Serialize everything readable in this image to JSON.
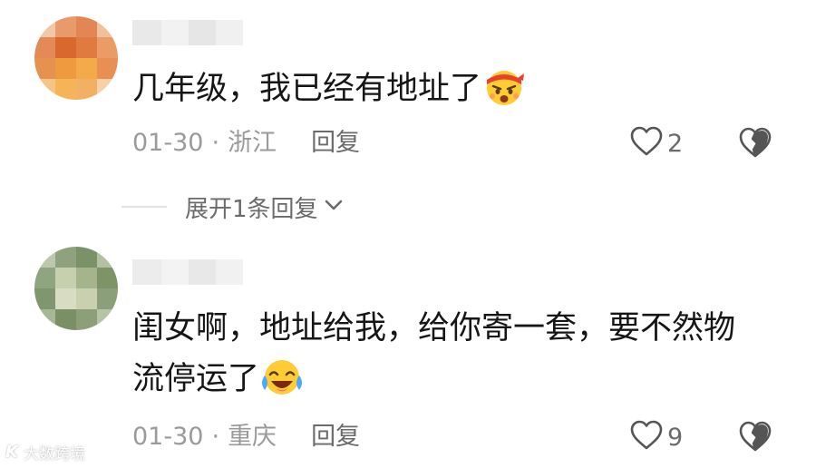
{
  "comments": [
    {
      "text_line1": "几年级，我已经有地址了",
      "text_line2": "",
      "emoji": "angry-headband-emoji",
      "date": "01-30",
      "separator": "·",
      "location": "浙江",
      "reply_label": "回复",
      "likes": "2"
    },
    {
      "text_line1": "闺女啊，地址给我，给你寄一套，要不然物",
      "text_line2": "流停运了",
      "emoji": "crying-laughing-emoji",
      "date": "01-30",
      "separator": "·",
      "location": "重庆",
      "reply_label": "回复",
      "likes": "9"
    }
  ],
  "expand_replies": {
    "label": "展开1条回复"
  },
  "watermark": {
    "logo_text": "K",
    "text": "大数跨境"
  },
  "colors": {
    "primary_text": "#161616",
    "meta_text": "#9a9a9a",
    "secondary_text": "#6b6b6b",
    "divider": "#e2e2e2"
  },
  "icons": [
    "heart-outline-icon",
    "broken-heart-icon",
    "chevron-down-icon"
  ]
}
